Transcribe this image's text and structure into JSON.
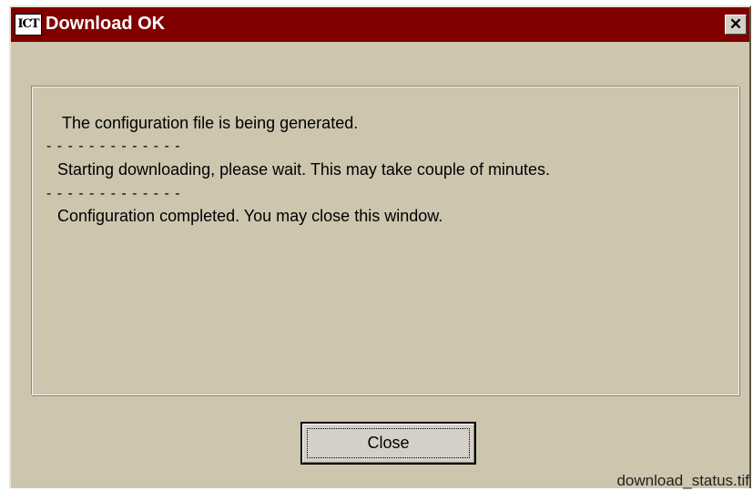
{
  "window": {
    "title": "Download OK",
    "icon_label": "ICT",
    "close_glyph": "✕"
  },
  "messages": {
    "line1": "The configuration file is being generated.",
    "separator1": "- - - - - - - - - - - - -",
    "line2": "Starting downloading, please wait. This may take couple of minutes.",
    "separator2": "- - - - - - - - - - - - -",
    "line3": "Configuration completed. You may close this window."
  },
  "buttons": {
    "close_label": "Close"
  },
  "caption": {
    "filename": "download_status.tif"
  },
  "colors": {
    "titlebar": "#800000",
    "window_bg": "#cdc5ae"
  },
  "icons": {
    "app": "app-icon",
    "close": "close-icon"
  }
}
